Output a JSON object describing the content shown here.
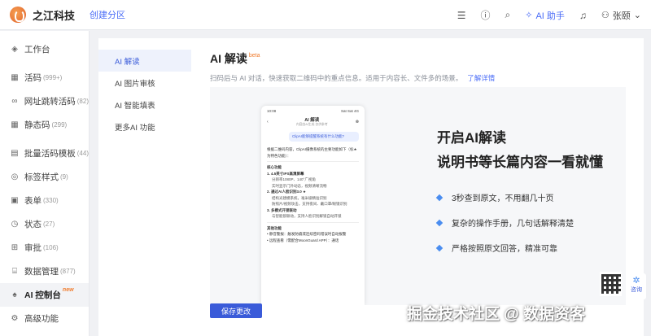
{
  "app": {
    "brand": "之江科技",
    "create_link": "创建分区"
  },
  "header": {
    "ai_assistant": "AI 助手",
    "user": "张颐",
    "icons": [
      "menu-icon",
      "help-icon",
      "search-icon",
      "bell-icon",
      "user-icon"
    ]
  },
  "sidebar": {
    "items": [
      {
        "icon": "cube-icon",
        "label": "工作台",
        "count": ""
      },
      {
        "icon": "grid-icon",
        "label": "活码",
        "count": "(999+)"
      },
      {
        "icon": "link-icon",
        "label": "网址跳转活码",
        "count": "(82)"
      },
      {
        "icon": "grid-icon",
        "label": "静态码",
        "count": "(299)"
      },
      {
        "icon": "template-icon",
        "label": "批量活码模板",
        "count": "(44)"
      },
      {
        "icon": "tag-icon",
        "label": "标签样式",
        "count": "(9)"
      },
      {
        "icon": "form-icon",
        "label": "表单",
        "count": "(330)"
      },
      {
        "icon": "status-icon",
        "label": "状态",
        "count": "(27)"
      },
      {
        "icon": "approve-icon",
        "label": "审批",
        "count": "(106)"
      },
      {
        "icon": "data-icon",
        "label": "数据管理",
        "count": "(877)"
      },
      {
        "icon": "ai-icon",
        "label": "AI 控制台",
        "count": "",
        "badge": "new"
      },
      {
        "icon": "settings-icon",
        "label": "高级功能",
        "count": ""
      }
    ]
  },
  "subnav": {
    "items": [
      "AI 解读",
      "AI 图片审核",
      "AI 智能填表",
      "更多AI 功能"
    ]
  },
  "content": {
    "title": "AI 解读",
    "beta": "beta",
    "desc": "扫码后与 AI 对话，快速获取二维码中的重点信息。适用于内容长、文件多的场景。",
    "learn_more": "了解详情",
    "promo_line1": "开启AI解读",
    "promo_line2": "说明书等长篇内容一看就懂",
    "bullets": [
      "3秒查到原文，不用翻几十页",
      "复杂的操作手册，几句话解释清楚",
      "严格按照原文回答，精准可靠"
    ],
    "save": "保存更改"
  },
  "phone": {
    "time": "10:08",
    "status": "Sat Sat 4G",
    "title": "AI 解读",
    "subtitle": "内容由AI生成 仅供参考",
    "question": "ClipAI能够提醒系统有什么功能?",
    "intro": "根据二维码内容，ClipAI摄像系统的主要功能如下（标★为特色功能）：",
    "sec1": "核心功能",
    "p1": "1. 4.5英寸IPS高清屏幕",
    "p1a": "分辨率1080P、140°广视角",
    "p1b": "实时显示门外动态，视频清晰流畅",
    "p2": "2. 通过AI人脸识别3.0 ★",
    "p2a": "结构光建模系统，毫米级精准识别",
    "p2b": "防照片/视频攻击，支持夜间、戴口罩/眼镜识别",
    "p3": "3. 多模式开锁联动",
    "p3a": "与智能锁联动，支持人脸识别解锁自动开锁",
    "sec2": "其他功能",
    "o1": "• 静音警报：触发防撬或连续密码错误时自动报警",
    "o2": "• 远程查看（需配合MoonGuard APP）：通话"
  },
  "helper": {
    "label": "咨询"
  },
  "watermark": "掘金技术社区 @ 数据资客"
}
